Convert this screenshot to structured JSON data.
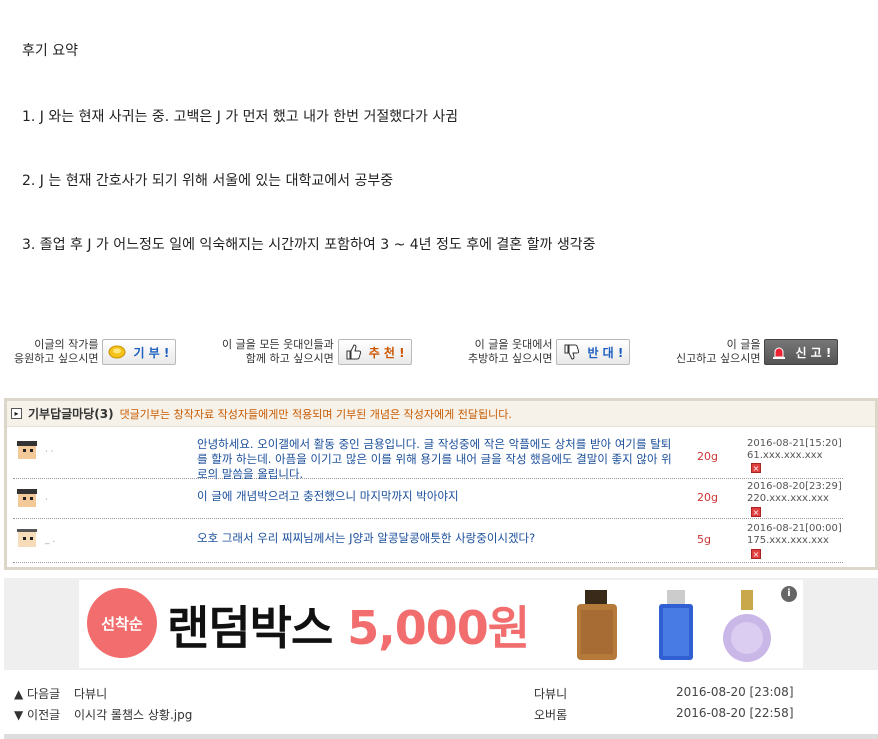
{
  "post": {
    "lines": [
      "후기 요약",
      "1. J 와는 현재 사귀는 중. 고백은 J 가 먼저 했고 내가 한번 거절했다가 사귐",
      "2. J 는 현재 간호사가 되기 위해 서울에 있는 대학교에서 공부중",
      "3. 졸업 후 J 가 어느정도 일에 익숙해지는 시간까지 포함하여 3 ~ 4년 정도 후에 결혼 할까 생각중"
    ]
  },
  "actions": {
    "give": {
      "line1": "이글의 작가를",
      "line2": "응원하고 싶으시면",
      "button": "기 부 !"
    },
    "recommend": {
      "line1": "이 글을 모든 웃대인들과",
      "line2": "함께 하고 싶으시면",
      "button": "추 천 !"
    },
    "oppose": {
      "line1": "이 글을 웃대에서",
      "line2": "추방하고 싶으시면",
      "button": "반 대 !"
    },
    "report": {
      "line1": "이 글을",
      "line2": "신고하고 싶으시면",
      "button": "신 고 !"
    }
  },
  "comments": {
    "title": "기부답글마당(3)",
    "subtitle": "댓글기부는 창작자료 작성자들에게만 적용되며 기부된 개념은 작성자에게 전달됩니다.",
    "items": [
      {
        "nick": "· ·",
        "text": "안녕하세요. 오이갤에서 활동 중인 금용입니다. 글 작성중에 작은 악플에도 상처를 받아 여기를 탈퇴를 할까 하는데. 아픔을 이기고 많은 이를 위해 용기를 내어 글을 작성 했음에도 결말이 좋지 않아 위로의 말씀을 올립니다.",
        "amount": "20g",
        "datetime": "2016-08-21[15:20]",
        "ip": "61.xxx.xxx.xxx"
      },
      {
        "nick": "·",
        "text": "이 글에 개념박으려고 충전했으니 마지막까지 박아야지",
        "amount": "20g",
        "datetime": "2016-08-20[23:29]",
        "ip": "220.xxx.xxx.xxx"
      },
      {
        "nick": "_ .",
        "text": "오호 그래서 우리 찌찌님께서는 J양과 알콩달콩애틋한 사랑중이시겠다?",
        "amount": "5g",
        "datetime": "2016-08-21[00:00]",
        "ip": "175.xxx.xxx.xxx"
      }
    ]
  },
  "ad": {
    "badge": "선착순",
    "headline": "랜덤박스",
    "price": "5,000원",
    "info": "i"
  },
  "nav": {
    "next": {
      "label": "▲ 다음글",
      "title": "다뷰니",
      "author": "다뷰니",
      "date": "2016-08-20 [23:08]"
    },
    "prev": {
      "label": "▼ 이전글",
      "title": "이시각 롤챔스 상황.jpg",
      "author": "오버롬",
      "date": "2016-08-20 [22:58]"
    }
  }
}
